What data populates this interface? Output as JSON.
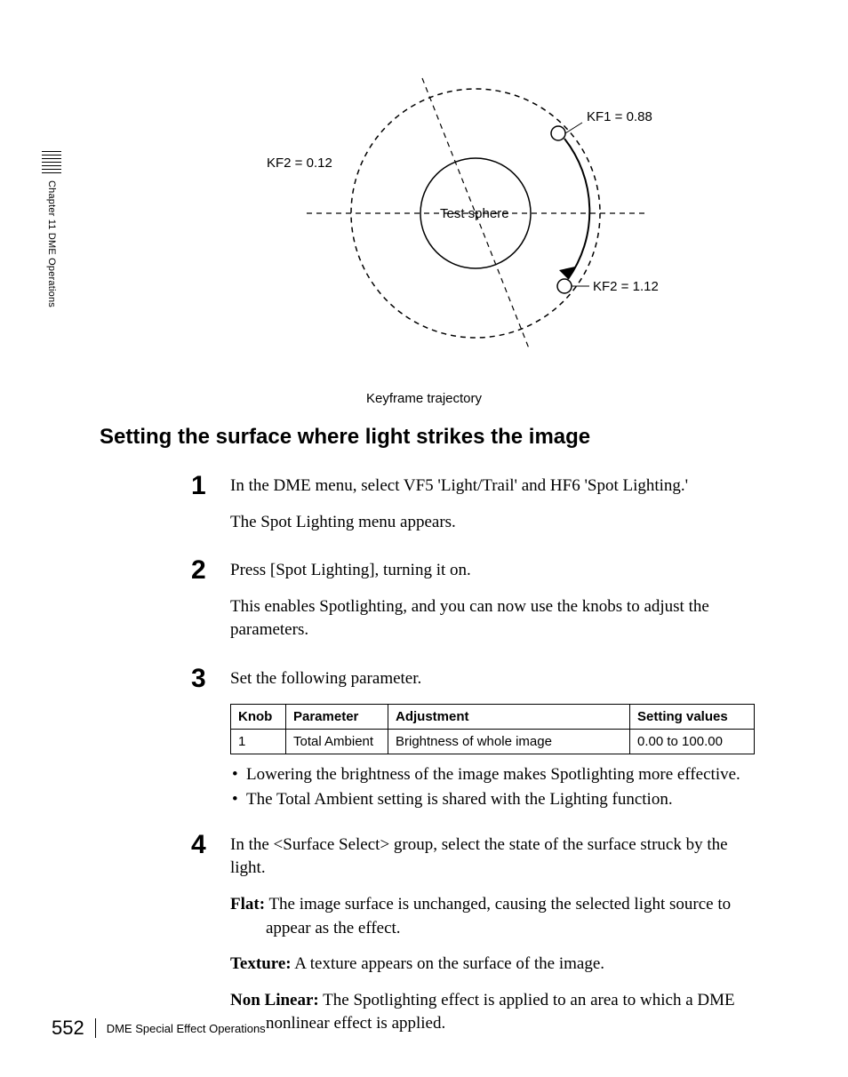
{
  "sidebar": {
    "label": "Chapter 11  DME Operations"
  },
  "diagram": {
    "kf1_label": "KF1 = 0.88",
    "kf2_left_label": "KF2 = 0.12",
    "kf2_right_label": "KF2 = 1.12",
    "center_label": "Test sphere",
    "caption": "Keyframe trajectory"
  },
  "heading": "Setting the surface where light strikes the image",
  "steps": {
    "s1": {
      "num": "1",
      "line1_a": "In the DME menu, select VF5 ",
      "line1_quote1": "'Light/Trail'",
      "line1_b": " and HF6 ",
      "line1_quote2": "'Spot Lighting.'",
      "line2": "The Spot Lighting menu appears."
    },
    "s2": {
      "num": "2",
      "line1": "Press [Spot Lighting], turning it on.",
      "line2": "This enables Spotlighting, and you can now use the knobs to adjust the parameters."
    },
    "s3": {
      "num": "3",
      "line1": "Set the following parameter.",
      "table": {
        "headers": [
          "Knob",
          "Parameter",
          "Adjustment",
          "Setting values"
        ],
        "row": [
          "1",
          "Total Ambient",
          "Brightness of whole image",
          "0.00 to 100.00"
        ]
      },
      "bullets": [
        "Lowering the brightness of the image makes Spotlighting more effective.",
        "The Total Ambient setting is shared with the Lighting function."
      ]
    },
    "s4": {
      "num": "4",
      "line1": "In the <Surface Select> group, select the state of the surface struck by the light.",
      "defs": [
        {
          "term": "Flat:",
          "body": " The image surface is unchanged, causing the selected light source to appear as the effect."
        },
        {
          "term": "Texture:",
          "body": " A texture appears on the surface of the image."
        },
        {
          "term": "Non Linear:",
          "body": " The Spotlighting effect is applied to an area to which a DME nonlinear effect is applied."
        }
      ]
    }
  },
  "footer": {
    "page": "552",
    "title": "DME Special Effect Operations"
  }
}
